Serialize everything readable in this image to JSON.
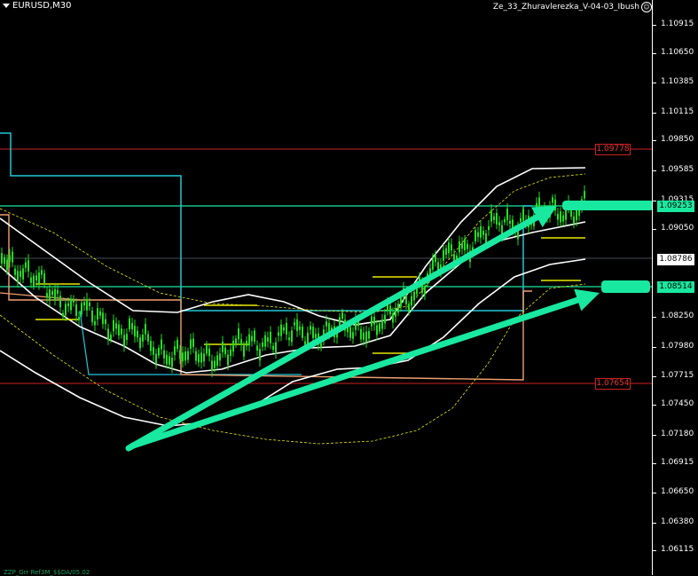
{
  "header": {
    "symbol": "EURUSD,M30",
    "indicator": "Ze_33_Zhuravlerezka_V-04-03_Ibush"
  },
  "price_axis": {
    "ticks": [
      "1.10915",
      "1.10650",
      "1.10385",
      "1.10115",
      "1.09850",
      "1.09585",
      "1.09315",
      "1.09050",
      "1.08786",
      "1.08514",
      "1.08250",
      "1.07980",
      "1.07715",
      "1.07450",
      "1.07180",
      "1.06915",
      "1.06650",
      "1.06380",
      "1.06115"
    ],
    "current_price": "1.08786",
    "level_upper": "1.09253",
    "level_lower": "1.08514"
  },
  "chart_levels": {
    "resistance_red": "1.09778",
    "support_red": "1.07654"
  },
  "footer": {
    "label": "ZZP_Grr Ref3M_$$DA/05.02"
  },
  "colors": {
    "background": "#000000",
    "candle": "#22dd22",
    "band": "#ffffff",
    "cyan_line": "#22c8d8",
    "salmon_line": "#f0a070",
    "red_level": "#cc2222",
    "teal_level": "#19e8a0",
    "yellow": "#e8e800"
  }
}
